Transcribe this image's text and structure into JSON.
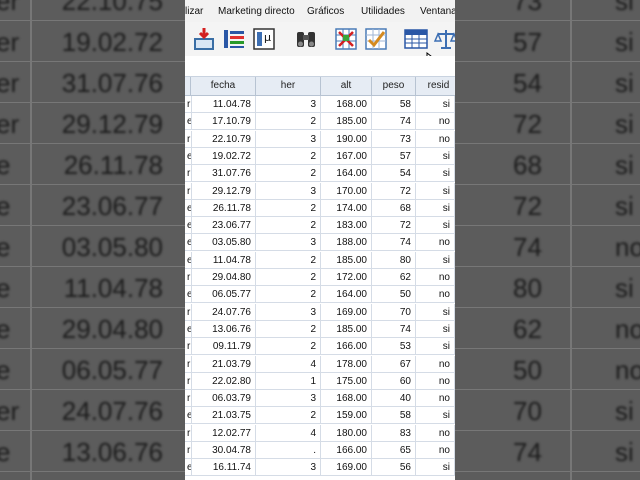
{
  "menu": {
    "items": [
      "lizar",
      "Marketing directo",
      "Gráficos",
      "Utilidades",
      "Ventana"
    ]
  },
  "toolbar": {
    "icons": [
      "import-data-icon",
      "variables-icon",
      "value-labels-icon",
      "find-icon",
      "select-cases-icon",
      "weight-cases-icon",
      "data-grid-icon",
      "scales-icon"
    ]
  },
  "columns": [
    "",
    "fecha",
    "her",
    "alt",
    "peso",
    "resid"
  ],
  "rows": [
    {
      "c0": "r",
      "fecha": "11.04.78",
      "her": "3",
      "alt": "168.00",
      "peso": "58",
      "resid": "si"
    },
    {
      "c0": "e",
      "fecha": "17.10.79",
      "her": "2",
      "alt": "185.00",
      "peso": "74",
      "resid": "no"
    },
    {
      "c0": "r",
      "fecha": "22.10.79",
      "her": "3",
      "alt": "190.00",
      "peso": "73",
      "resid": "no"
    },
    {
      "c0": "e",
      "fecha": "19.02.72",
      "her": "2",
      "alt": "167.00",
      "peso": "57",
      "resid": "si"
    },
    {
      "c0": "r",
      "fecha": "31.07.76",
      "her": "2",
      "alt": "164.00",
      "peso": "54",
      "resid": "si"
    },
    {
      "c0": "r",
      "fecha": "29.12.79",
      "her": "3",
      "alt": "170.00",
      "peso": "72",
      "resid": "si"
    },
    {
      "c0": "e",
      "fecha": "26.11.78",
      "her": "2",
      "alt": "174.00",
      "peso": "68",
      "resid": "si"
    },
    {
      "c0": "e",
      "fecha": "23.06.77",
      "her": "2",
      "alt": "183.00",
      "peso": "72",
      "resid": "si"
    },
    {
      "c0": "e",
      "fecha": "03.05.80",
      "her": "3",
      "alt": "188.00",
      "peso": "74",
      "resid": "no"
    },
    {
      "c0": "e",
      "fecha": "11.04.78",
      "her": "2",
      "alt": "185.00",
      "peso": "80",
      "resid": "si"
    },
    {
      "c0": "r",
      "fecha": "29.04.80",
      "her": "2",
      "alt": "172.00",
      "peso": "62",
      "resid": "no"
    },
    {
      "c0": "e",
      "fecha": "06.05.77",
      "her": "2",
      "alt": "164.00",
      "peso": "50",
      "resid": "no"
    },
    {
      "c0": "r",
      "fecha": "24.07.76",
      "her": "3",
      "alt": "169.00",
      "peso": "70",
      "resid": "si"
    },
    {
      "c0": "e",
      "fecha": "13.06.76",
      "her": "2",
      "alt": "185.00",
      "peso": "74",
      "resid": "si"
    },
    {
      "c0": "r",
      "fecha": "09.11.79",
      "her": "2",
      "alt": "166.00",
      "peso": "53",
      "resid": "si"
    },
    {
      "c0": "r",
      "fecha": "21.03.79",
      "her": "4",
      "alt": "178.00",
      "peso": "67",
      "resid": "no"
    },
    {
      "c0": "r",
      "fecha": "22.02.80",
      "her": "1",
      "alt": "175.00",
      "peso": "60",
      "resid": "no"
    },
    {
      "c0": "r",
      "fecha": "06.03.79",
      "her": "3",
      "alt": "168.00",
      "peso": "40",
      "resid": "no"
    },
    {
      "c0": "e",
      "fecha": "21.03.75",
      "her": "2",
      "alt": "159.00",
      "peso": "58",
      "resid": "si"
    },
    {
      "c0": "r",
      "fecha": "12.02.77",
      "her": "4",
      "alt": "180.00",
      "peso": "83",
      "resid": "no"
    },
    {
      "c0": "r",
      "fecha": "30.04.78",
      "her": ".",
      "alt": "166.00",
      "peso": "65",
      "resid": "no"
    },
    {
      "c0": "e",
      "fecha": "16.11.74",
      "her": "3",
      "alt": "169.00",
      "peso": "56",
      "resid": "si"
    }
  ],
  "background_left": [
    {
      "a": "er",
      "b": "22.10.75"
    },
    {
      "a": "er",
      "b": "19.02.72"
    },
    {
      "a": "er",
      "b": "31.07.76"
    },
    {
      "a": "er",
      "b": "29.12.79"
    },
    {
      "a": "e",
      "b": "26.11.78"
    },
    {
      "a": "e",
      "b": "23.06.77"
    },
    {
      "a": "e",
      "b": "03.05.80"
    },
    {
      "a": "e",
      "b": "11.04.78"
    },
    {
      "a": "e",
      "b": "29.04.80"
    },
    {
      "a": "e",
      "b": "06.05.77"
    },
    {
      "a": "er",
      "b": "24.07.76"
    },
    {
      "a": "e",
      "b": "13.06.76"
    }
  ],
  "background_right": [
    {
      "a": "73",
      "b": "si"
    },
    {
      "a": "57",
      "b": "si"
    },
    {
      "a": "54",
      "b": "si"
    },
    {
      "a": "72",
      "b": "si"
    },
    {
      "a": "68",
      "b": "si"
    },
    {
      "a": "72",
      "b": "si"
    },
    {
      "a": "74",
      "b": "no"
    },
    {
      "a": "80",
      "b": "si"
    },
    {
      "a": "62",
      "b": "no"
    },
    {
      "a": "50",
      "b": "no"
    },
    {
      "a": "70",
      "b": "si"
    },
    {
      "a": "74",
      "b": "si"
    }
  ]
}
